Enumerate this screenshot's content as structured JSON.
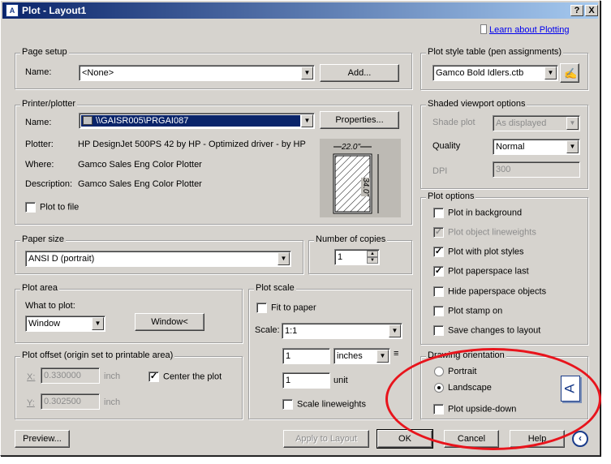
{
  "window": {
    "title": "Plot - Layout1",
    "help_btn": "?",
    "close_btn": "X"
  },
  "learn_link": "Learn about Plotting",
  "page_setup": {
    "group": "Page setup",
    "name_label": "Name:",
    "name_value": "<None>",
    "add_button": "Add..."
  },
  "printer": {
    "group": "Printer/plotter",
    "name_label": "Name:",
    "name_value": "\\\\GAISR005\\PRGAI087",
    "properties_button": "Properties...",
    "plotter_label": "Plotter:",
    "plotter_value": "HP DesignJet 500PS 42 by HP - Optimized driver - by HP",
    "where_label": "Where:",
    "where_value": "Gamco Sales Eng Color Plotter",
    "description_label": "Description:",
    "description_value": "Gamco Sales Eng Color Plotter",
    "plot_to_file": "Plot to file",
    "preview_width": "22.0\"",
    "preview_height": "34.0\""
  },
  "paper_size": {
    "group": "Paper size",
    "value": "ANSI D (portrait)"
  },
  "copies": {
    "group": "Number of copies",
    "value": "1"
  },
  "plot_area": {
    "group": "Plot area",
    "what_label": "What to plot:",
    "value": "Window",
    "window_button": "Window<"
  },
  "plot_offset": {
    "group": "Plot offset (origin set to printable area)",
    "x_label": "X:",
    "x_value": "0.330000",
    "x_unit": "inch",
    "y_label": "Y:",
    "y_value": "0.302500",
    "y_unit": "inch",
    "center": "Center the plot"
  },
  "plot_scale": {
    "group": "Plot scale",
    "fit": "Fit to paper",
    "scale_label": "Scale:",
    "scale_value": "1:1",
    "num1": "1",
    "units": "inches",
    "num2": "1",
    "unit_label": "unit",
    "scale_lineweights": "Scale lineweights"
  },
  "plot_style": {
    "group": "Plot style table (pen assignments)",
    "value": "Gamco Bold Idlers.ctb"
  },
  "shaded": {
    "group": "Shaded viewport options",
    "shade_label": "Shade plot",
    "shade_value": "As displayed",
    "quality_label": "Quality",
    "quality_value": "Normal",
    "dpi_label": "DPI",
    "dpi_value": "300"
  },
  "plot_options": {
    "group": "Plot options",
    "items": [
      {
        "label": "Plot in background",
        "checked": ""
      },
      {
        "label": "Plot object lineweights",
        "checked": "✓"
      },
      {
        "label": "Plot with plot styles",
        "checked": "✓"
      },
      {
        "label": "Plot paperspace last",
        "checked": "✓"
      },
      {
        "label": "Hide paperspace objects",
        "checked": ""
      },
      {
        "label": "Plot stamp on",
        "checked": ""
      },
      {
        "label": "Save changes to layout",
        "checked": ""
      }
    ]
  },
  "orientation": {
    "group": "Drawing orientation",
    "portrait": "Portrait",
    "landscape": "Landscape",
    "upside_down": "Plot upside-down",
    "icon_letter": "A"
  },
  "footer": {
    "preview": "Preview...",
    "apply": "Apply to Layout",
    "ok": "OK",
    "cancel": "Cancel",
    "help": "Help"
  },
  "colors": {
    "annotation_ellipse": "#e8141c",
    "title_gradient_start": "#0a246a",
    "dialog_bg": "#d6d3ce"
  }
}
